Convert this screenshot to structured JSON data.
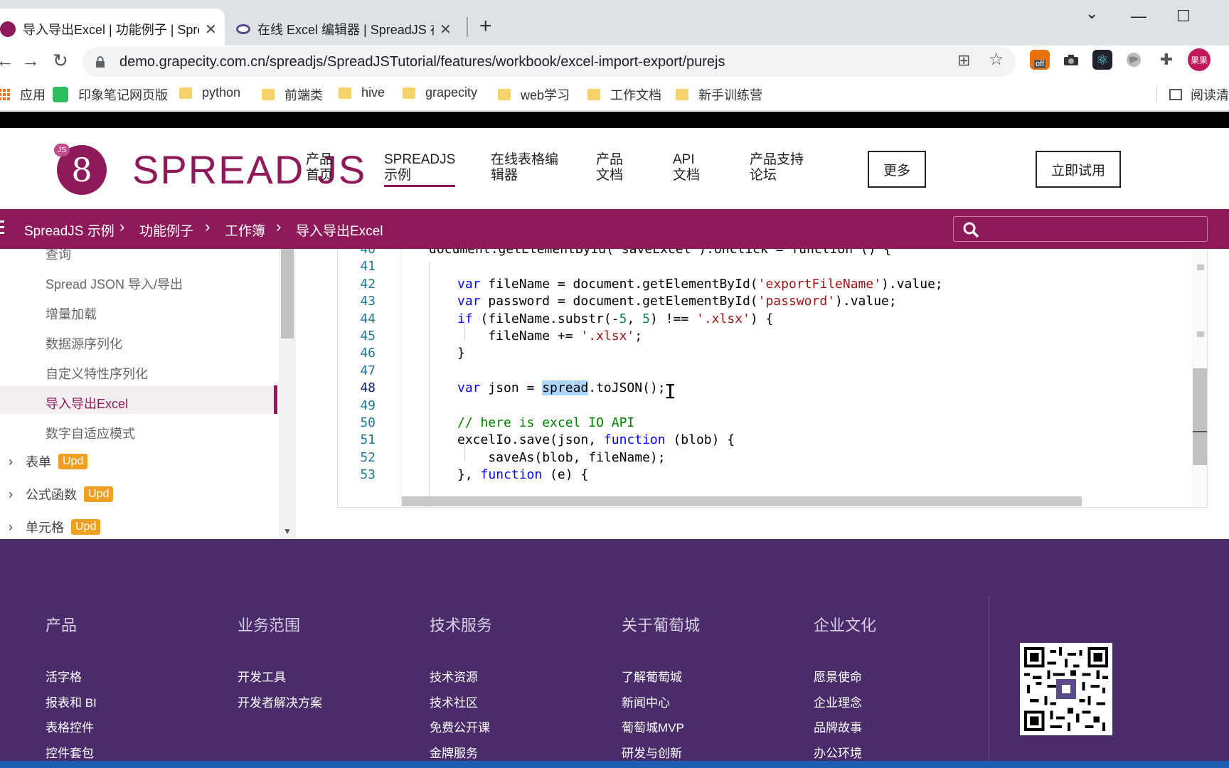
{
  "browser": {
    "tabs": [
      {
        "title": "导入导出Excel | 功能例子 | SpreadJS",
        "active": true
      },
      {
        "title": "在线 Excel 编辑器 | SpreadJS 在线",
        "active": false
      }
    ],
    "close_glyph": "✕",
    "new_tab_glyph": "+",
    "window_controls": {
      "minimize": "—",
      "maximize": "☐",
      "chevron": "⌄"
    },
    "url": "demo.grapecity.com.cn/spreadjs/SpreadJSTutorial/features/workbook/excel-import-export/purejs",
    "back_glyph": "←",
    "forward_glyph": "→",
    "reload_glyph": "↻",
    "translate_glyph": "⊞",
    "star_glyph": "☆",
    "extensions": [
      {
        "icon": "off-badge-icon",
        "label": "off"
      },
      {
        "icon": "camera-icon",
        "label": ""
      },
      {
        "icon": "react-icon",
        "label": "⚛"
      },
      {
        "icon": "globe-icon",
        "label": ""
      },
      {
        "icon": "puzzle-icon",
        "label": "✚"
      }
    ],
    "profile_label": "果果",
    "bookmarks": [
      {
        "label": "应用",
        "type": "apps"
      },
      {
        "label": "印象笔记网页版",
        "type": "evernote"
      },
      {
        "label": "python",
        "type": "folder"
      },
      {
        "label": "前端类",
        "type": "folder"
      },
      {
        "label": "hive",
        "type": "folder"
      },
      {
        "label": "grapecity",
        "type": "folder"
      },
      {
        "label": "web学习",
        "type": "folder"
      },
      {
        "label": "工作文档",
        "type": "folder"
      },
      {
        "label": "新手训练营",
        "type": "folder"
      }
    ],
    "reading_list": "阅读清"
  },
  "site": {
    "logo_js": "JS",
    "logo_text": "SPREAD JS",
    "nav": [
      {
        "label": "产品\n首页",
        "active": false
      },
      {
        "label": "SPREADJS\n示例",
        "active": true
      },
      {
        "label": "在线表格编\n辑器",
        "active": false
      },
      {
        "label": "产品\n文档",
        "active": false
      },
      {
        "label": "API\n文档",
        "active": false
      },
      {
        "label": "产品支持\n论坛",
        "active": false
      }
    ],
    "more_button": "更多",
    "try_button": "立即试用",
    "accent_color": "#8e1a5a"
  },
  "breadcrumb": [
    "SpreadJS 示例",
    "功能例子",
    "工作簿",
    "导入导出Excel"
  ],
  "sidebar": {
    "items": [
      {
        "label": "查询",
        "active": false
      },
      {
        "label": "Spread JSON 导入/导出",
        "active": false
      },
      {
        "label": "增量加载",
        "active": false
      },
      {
        "label": "数据源序列化",
        "active": false
      },
      {
        "label": "自定义特性序列化",
        "active": false
      },
      {
        "label": "导入导出Excel",
        "active": true
      },
      {
        "label": "数字自适应模式",
        "active": false
      }
    ],
    "groups": [
      {
        "label": "表单",
        "badge": "Upd"
      },
      {
        "label": "公式函数",
        "badge": "Upd"
      },
      {
        "label": "单元格",
        "badge": "Upd"
      }
    ]
  },
  "editor": {
    "current_line": 48,
    "lines": [
      {
        "n": 40,
        "tokens": [
          [
            "document.getElementById('saveExcel').onclick = function () {",
            ""
          ]
        ]
      },
      {
        "n": 41,
        "tokens": []
      },
      {
        "n": 42,
        "tokens": [
          [
            "var",
            "kw"
          ],
          [
            " fileName = document.getElementById(",
            ""
          ],
          [
            "'exportFileName'",
            "str"
          ],
          [
            ").value;",
            ""
          ]
        ]
      },
      {
        "n": 43,
        "tokens": [
          [
            "var",
            "kw"
          ],
          [
            " password = document.getElementById(",
            ""
          ],
          [
            "'password'",
            "str"
          ],
          [
            ").value;",
            ""
          ]
        ]
      },
      {
        "n": 44,
        "tokens": [
          [
            "if",
            "kw"
          ],
          [
            " (fileName.substr(-",
            ""
          ],
          [
            "5",
            "num"
          ],
          [
            ", ",
            ""
          ],
          [
            "5",
            "num"
          ],
          [
            ") !== ",
            ""
          ],
          [
            "'.xlsx'",
            "str"
          ],
          [
            ") {",
            ""
          ]
        ]
      },
      {
        "n": 45,
        "tokens": [
          [
            "    fileName += ",
            ""
          ],
          [
            "'.xlsx'",
            "str"
          ],
          [
            ";",
            ""
          ]
        ]
      },
      {
        "n": 46,
        "tokens": [
          [
            "}",
            ""
          ]
        ]
      },
      {
        "n": 47,
        "tokens": []
      },
      {
        "n": 48,
        "tokens": [
          [
            "var",
            "kw"
          ],
          [
            " json = ",
            ""
          ],
          [
            "spread",
            "hl"
          ],
          [
            ".toJSON();",
            ""
          ]
        ]
      },
      {
        "n": 49,
        "tokens": []
      },
      {
        "n": 50,
        "tokens": [
          [
            "// here is excel IO API",
            "cmt"
          ]
        ]
      },
      {
        "n": 51,
        "tokens": [
          [
            "excelIo.save(json, ",
            ""
          ],
          [
            "function",
            "kw"
          ],
          [
            " (blob) {",
            ""
          ]
        ]
      },
      {
        "n": 52,
        "tokens": [
          [
            "    saveAs(blob, fileName);",
            ""
          ]
        ]
      },
      {
        "n": 53,
        "tokens": [
          [
            "}, ",
            ""
          ],
          [
            "function",
            "kw"
          ],
          [
            " (e) {",
            ""
          ]
        ]
      }
    ]
  },
  "footer": {
    "columns": [
      {
        "heading": "产品",
        "links": [
          "活字格",
          "报表和 BI",
          "表格控件",
          "控件套包"
        ]
      },
      {
        "heading": "业务范围",
        "links": [
          "开发工具",
          "开发者解决方案"
        ]
      },
      {
        "heading": "技术服务",
        "links": [
          "技术资源",
          "技术社区",
          "免费公开课",
          "金牌服务"
        ]
      },
      {
        "heading": "关于葡萄城",
        "links": [
          "了解葡萄城",
          "新闻中心",
          "葡萄城MVP",
          "研发与创新"
        ]
      },
      {
        "heading": "企业文化",
        "links": [
          "愿景使命",
          "企业理念",
          "品牌故事",
          "办公环境"
        ]
      }
    ],
    "background_color": "#4a2c6a"
  }
}
